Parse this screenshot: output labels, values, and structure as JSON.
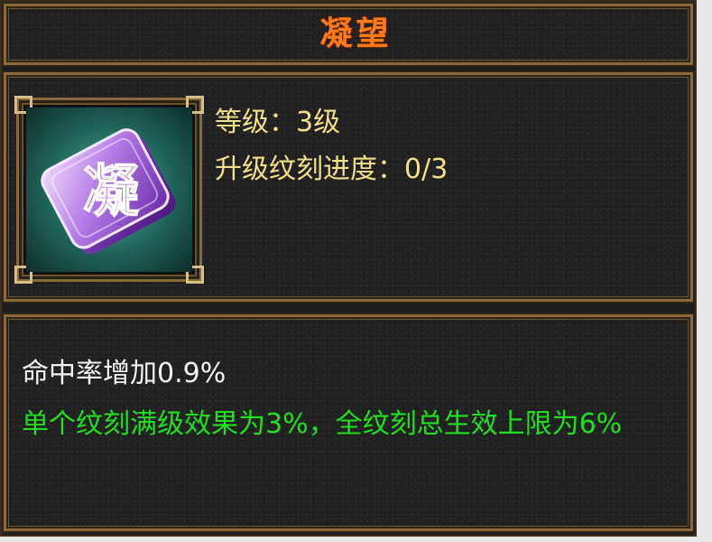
{
  "title": "凝望",
  "icon": {
    "name": "rune-ning-icon",
    "glyph": "凝"
  },
  "info": {
    "level_label": "等级：",
    "level_value": "3级",
    "progress_label": "升级纹刻进度：",
    "progress_value": "0/3"
  },
  "description": {
    "effect": "命中率增加0.9%",
    "note": "单个纹刻满级效果为3%，全纹刻总生效上限为6%"
  },
  "colors": {
    "title": "#ff7a18",
    "info_text": "#f2e08a",
    "effect_text": "#f4f4f4",
    "note_text": "#1fe01f",
    "frame_gold": "#8a6a3a"
  }
}
